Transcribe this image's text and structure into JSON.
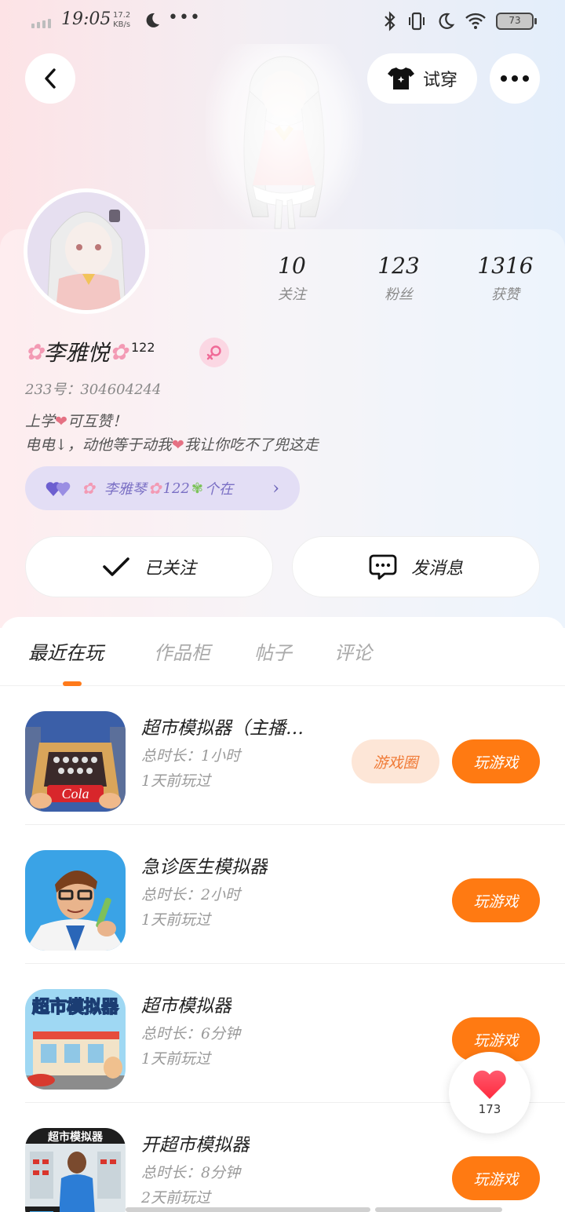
{
  "status_bar": {
    "time": "19:05",
    "net_speed_value": "17.2",
    "net_speed_unit": "KB/s",
    "battery": "73"
  },
  "header": {
    "try_on_label": "试穿"
  },
  "profile": {
    "name": "李雅悦",
    "name_suffix": "122",
    "uid_label": "233号：",
    "uid": "304604244",
    "bio_line1_a": "上学",
    "bio_line1_b": "可互赞！",
    "bio_line2_a": "电电↓，动他等于动我",
    "bio_line2_b": "我让你吃不了兜这走",
    "relation": "李雅琴",
    "relation_suffix": "122",
    "relation_tail": "个在"
  },
  "stats": [
    {
      "value": "10",
      "label": "关注"
    },
    {
      "value": "123",
      "label": "粉丝"
    },
    {
      "value": "1316",
      "label": "获赞"
    }
  ],
  "actions": {
    "follow_label": "已关注",
    "message_label": "发消息"
  },
  "tabs": [
    "最近在玩",
    "作品柜",
    "帖子",
    "评论"
  ],
  "games": [
    {
      "title": "超市模拟器（主播…",
      "duration": "总时长：1小时",
      "last_played": "1天前玩过",
      "circle_label": "游戏圈",
      "play_label": "玩游戏"
    },
    {
      "title": "急诊医生模拟器",
      "duration": "总时长：2小时",
      "last_played": "1天前玩过",
      "play_label": "玩游戏"
    },
    {
      "title": "超市模拟器",
      "duration": "总时长：6分钟",
      "last_played": "1天前玩过",
      "play_label": "玩游戏"
    },
    {
      "title": "开超市模拟器",
      "duration": "总时长：8分钟",
      "last_played": "2天前玩过",
      "play_label": "玩游戏"
    }
  ],
  "icon_texts": {
    "game1": "Cola",
    "game3": "超市模拟器",
    "game4": "超市模拟器"
  },
  "float_like": {
    "count": "173"
  },
  "colors": {
    "accent": "#ff7a12",
    "circle_btn_bg": "#fde6d7",
    "chip_bg": "#e3def5"
  }
}
